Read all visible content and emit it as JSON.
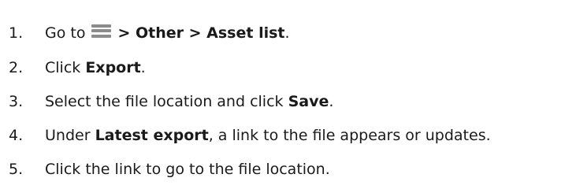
{
  "steps": [
    {
      "number": "1.",
      "go_to": "Go to",
      "icon": "hamburger-menu-icon",
      "path": "> Other > Asset list",
      "end": "."
    },
    {
      "number": "2.",
      "pre": "Click ",
      "bold": "Export",
      "post": "."
    },
    {
      "number": "3.",
      "pre": "Select the file location and click ",
      "bold": "Save",
      "post": "."
    },
    {
      "number": "4.",
      "pre": "Under ",
      "bold": "Latest export",
      "post": ", a link to the file appears or updates."
    },
    {
      "number": "5.",
      "text": "Click the link to go to the file location."
    }
  ],
  "colors": {
    "text": "#1a1a1a",
    "icon": "#8c8c8c",
    "background": "#ffffff"
  }
}
